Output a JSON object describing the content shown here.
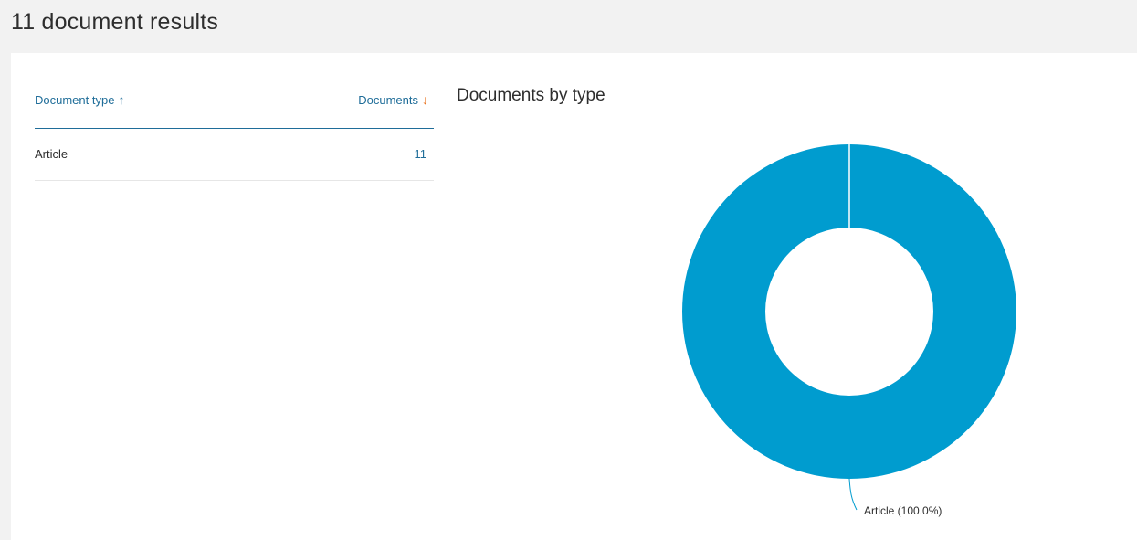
{
  "header": {
    "title": "11 document results"
  },
  "table": {
    "col_type_label": "Document type",
    "col_docs_label": "Documents",
    "sort_asc_icon": "arrow-up-icon",
    "sort_desc_icon": "arrow-down-icon",
    "rows": [
      {
        "type": "Article",
        "count": "11"
      }
    ]
  },
  "colors": {
    "accent": "#1f6d99",
    "sort_active": "#e9711c",
    "slice": "#009ccf"
  },
  "chart_data": {
    "type": "pie",
    "title": "Documents by type",
    "donut": true,
    "categories": [
      "Article"
    ],
    "values": [
      11
    ],
    "labels": [
      "Article (100.0%)"
    ]
  }
}
